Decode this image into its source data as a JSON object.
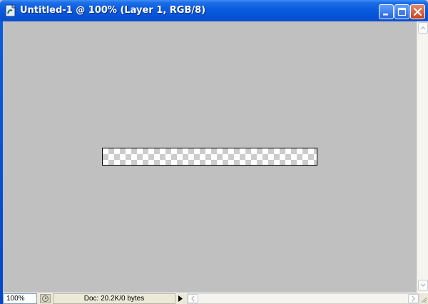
{
  "window": {
    "title": "Untitled-1 @ 100% (Layer 1, RGB/8)"
  },
  "statusbar": {
    "zoom": "100%",
    "doc_info": "Doc: 20.2K/0 bytes"
  },
  "colors": {
    "titlebar": "#0a5de0",
    "workspace": "#c0c0c0",
    "close_button": "#c5401b",
    "statusbar": "#ece9d8"
  },
  "icons": {
    "app": "photoshop-document-icon",
    "minimize": "minimize-icon",
    "maximize": "maximize-icon",
    "close": "close-icon",
    "status_menu": "status-menu-arrow-icon"
  }
}
